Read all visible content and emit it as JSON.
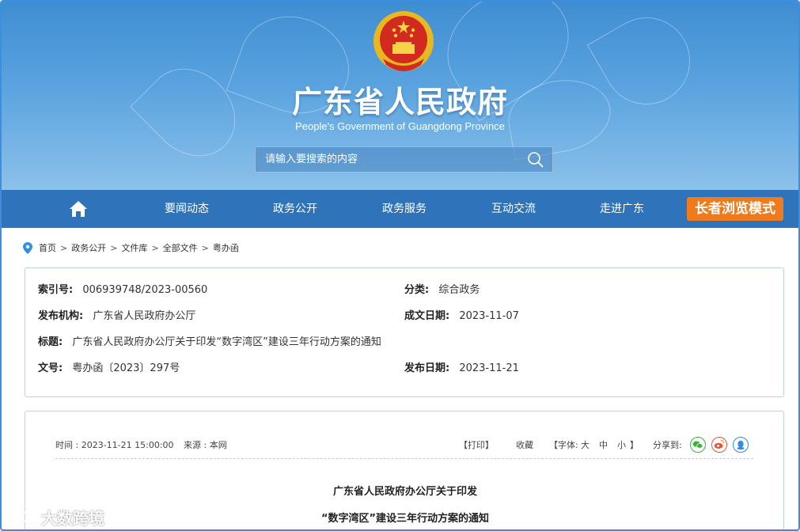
{
  "header": {
    "title": "广东省人民政府",
    "subtitle": "People's Government of Guangdong Province",
    "search_placeholder": "请输入要搜索的内容"
  },
  "nav": {
    "items": [
      "要闻动态",
      "政务公开",
      "政务服务",
      "互动交流",
      "走进广东"
    ],
    "elder_mode": "长者浏览模式"
  },
  "breadcrumb": [
    "首页",
    "政务公开",
    "文件库",
    "全部文件",
    "粤办函"
  ],
  "meta": {
    "index_label": "索引号:",
    "index_value": "006939748/2023-00560",
    "category_label": "分类:",
    "category_value": "综合政务",
    "issuer_label": "发布机构:",
    "issuer_value": "广东省人民政府办公厅",
    "written_label": "成文日期:",
    "written_value": "2023-11-07",
    "title_label": "标题:",
    "title_value": "广东省人民政府办公厅关于印发“数字湾区”建设三年行动方案的通知",
    "docno_label": "文号:",
    "docno_value": "粤办函〔2023〕297号",
    "published_label": "发布日期:",
    "published_value": "2023-11-21"
  },
  "article": {
    "time": "时间 : 2023-11-21 15:00:00",
    "source": "来源 : 本网",
    "print": "【打印】",
    "favorite": "收藏",
    "font_open": "【字体:",
    "font_large": "大",
    "font_medium": "中",
    "font_small": "小",
    "font_close": "】",
    "share": "分享到:",
    "title_line1": "广东省人民政府办公厅关于印发",
    "title_line2": "“数字湾区”建设三年行动方案的通知"
  },
  "watermark": "大数跨境",
  "colors": {
    "nav": "#2f74bb",
    "elder_button": "#f07b1c",
    "wechat": "#3bb03b",
    "weibo": "#e6543a",
    "qq": "#2f8fe0"
  }
}
